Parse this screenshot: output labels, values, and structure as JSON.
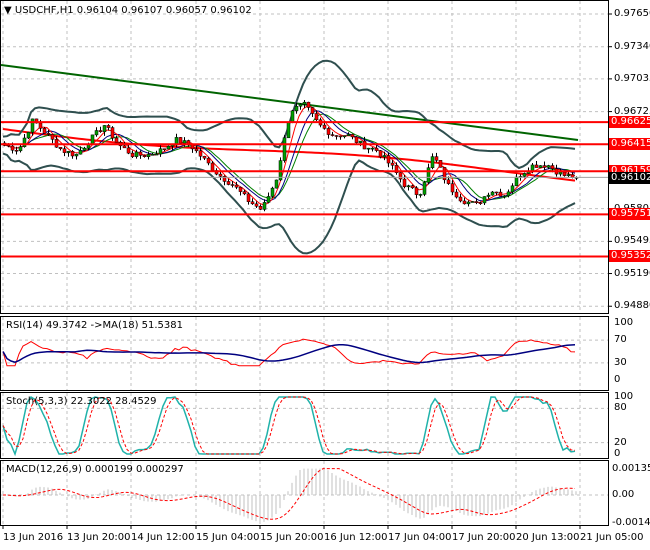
{
  "symbol_header": {
    "symbol": "USDCHF,H1",
    "ohlc": "0.96104 0.96107 0.96057 0.96102",
    "menu_icon": "triangle-down-icon"
  },
  "colors": {
    "bull": "#00a000",
    "bear": "#ff0000",
    "level": "#ff0000",
    "bollinger": "#2f4f4f",
    "ma_long": "#006400",
    "rsi": "#ff0000",
    "rsi_ma": "#000080",
    "stoch_main": "#20b2aa",
    "stoch_signal": "#ff0000",
    "macd_hist": "#c0c0c0",
    "macd_signal": "#ff0000",
    "grid": "#c0c0c0"
  },
  "price_axis": {
    "ticks": [
      "0.97650",
      "0.97340",
      "0.97035",
      "0.96725",
      "0.95805",
      "0.95495",
      "0.95190",
      "0.94880"
    ],
    "tick_values": [
      0.9765,
      0.9734,
      0.97035,
      0.96725,
      0.95805,
      0.95495,
      0.9519,
      0.9488
    ]
  },
  "levels": [
    {
      "label": "0.96625",
      "value": 0.96625
    },
    {
      "label": "0.96415",
      "value": 0.96415
    },
    {
      "label": "0.96159",
      "value": 0.96159
    },
    {
      "label": "0.95751",
      "value": 0.95751
    },
    {
      "label": "0.95352",
      "value": 0.95352
    }
  ],
  "current_price": {
    "label": "0.96102",
    "value": 0.96102
  },
  "time_axis": [
    "13 Jun 2016",
    "13 Jun 20:00",
    "14 Jun 12:00",
    "15 Jun 04:00",
    "15 Jun 20:00",
    "16 Jun 12:00",
    "17 Jun 04:00",
    "17 Jun 20:00",
    "20 Jun 13:00",
    "21 Jun 05:00"
  ],
  "rsi": {
    "label": "RSI(14) 49.3742  ->MA(18) 51.5381",
    "ticks": [
      "100",
      "70",
      "30",
      "0"
    ],
    "tick_values": [
      100,
      70,
      30,
      0
    ]
  },
  "stoch": {
    "label": "Stoch(5,3,3) 22.3022 28.4529",
    "ticks": [
      "100",
      "80",
      "20",
      "0"
    ],
    "tick_values": [
      100,
      80,
      20,
      0
    ]
  },
  "macd": {
    "label": "MACD(12,26,9) 0.000199 0.000297",
    "ticks": [
      "0.001351",
      "0.00",
      "-0.001416"
    ],
    "tick_values": [
      0.001351,
      0,
      -0.001416
    ]
  },
  "chart_data": {
    "type": "candlestick",
    "timeframe": "H1",
    "price_range": [
      0.9488,
      0.9775
    ],
    "approx_close_path": [
      0.96408,
      0.96361,
      0.96645,
      0.96503,
      0.96361,
      0.96313,
      0.96456,
      0.96598,
      0.96408,
      0.96313,
      0.96313,
      0.96361,
      0.96456,
      0.96408,
      0.96266,
      0.96124,
      0.96029,
      0.95887,
      0.95792,
      0.96077,
      0.9674,
      0.96787,
      0.96598,
      0.96503,
      0.96503,
      0.96408,
      0.96361,
      0.96219,
      0.96029,
      0.95934,
      0.96313,
      0.96029,
      0.95887,
      0.9584,
      0.95982,
      0.95934,
      0.96124,
      0.96219,
      0.96219,
      0.96124,
      0.96102
    ],
    "ma_long": [
      0.97167,
      0.96456
    ],
    "ma_red": [
      0.9656,
      0.961
    ]
  }
}
